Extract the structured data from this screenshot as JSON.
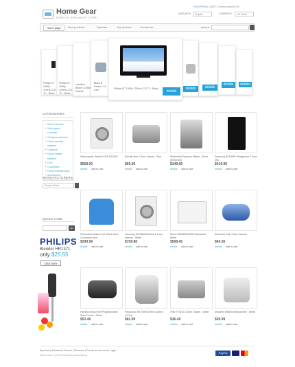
{
  "header": {
    "title": "Home Gear",
    "tagline": "DOMESTIC APPLIANCES STORE",
    "top_links": "SHOPPING CART   0 items total $0.00",
    "top_link_cart": "SHOPPING CART",
    "top_link_rest": "0 items total $0.00",
    "currency_label": "CURRENCY",
    "currency_value": "US Dollar",
    "language_label": "LANGUAGE",
    "language_value": "English"
  },
  "nav": {
    "items": [
      "Home page",
      "New products",
      "Specials",
      "My account",
      "Contact us"
    ],
    "search_label": "search"
  },
  "carousel": {
    "featured_text": "Philips 47\" 1080p 120Hz LCD TV - Black",
    "details_label": "details",
    "side_cards": [
      {
        "text": "Philips 47\" 1080p 120Hz LCD TV - Black"
      },
      {
        "text": "Hamilton Beach 4-Slice Toaster"
      },
      {
        "text": "Black & Decker 1.5-Liter"
      },
      {
        "text": "Black & Decker"
      }
    ]
  },
  "sidebar": {
    "categories_title": "CATEGORIES",
    "categories": [
      "Sound devices",
      "Video game consoles",
      "Cell phone/phones",
      "Home security systems",
      "Cameras",
      "Home theater systems",
      "DVD",
      "Computers",
      "Home entertainment",
      "Accessories"
    ],
    "manufacturers_title": "MANUFACTURERS",
    "manufacturers_select": "Please Select",
    "quick_find_title": "QUICK FIND",
    "quick_find_button": "go",
    "ad": {
      "brand": "PHILIPS",
      "product": "Blender HR1371",
      "only": "only",
      "price": "$25.55",
      "cta": "click here"
    }
  },
  "products": [
    {
      "name": "Samsung Air Perfect's WF-R125NC",
      "price": "$558.00",
      "icon": "washing-machine-icon"
    },
    {
      "name": "Breville Ikon 2-Slice Toaster - Blue",
      "price": "$65.95",
      "icon": "toaster-icon"
    },
    {
      "name": "KitchenAid Espresso Maker - Silver (KES2102)",
      "price": "$149.99",
      "icon": "espresso-icon"
    },
    {
      "name": "Samsung RS2555S Refrigerator 2 Door 35C",
      "price": "$419.99",
      "icon": "wine-cooler-icon"
    },
    {
      "name": "KitchenAid Artisan 5-Qt Stand Mixer Cornflower Blue",
      "price": "$299.99",
      "icon": "mixer-icon"
    },
    {
      "name": "Samsung WF338AAW/XAA 2-Load Washer - White",
      "price": "$708.88",
      "icon": "washing-machine-icon"
    },
    {
      "name": "Bosch SMS40E02GB Dishwasher White",
      "price": "$568.45",
      "icon": "dishwasher-icon"
    },
    {
      "name": "Electrolux Twin Clean Vacuum",
      "price": "$49.56",
      "icon": "vacuum-icon"
    },
    {
      "name": "Hamilton Beach Set Programmable Slow Cooker - Silver",
      "price": "$52.49",
      "icon": "slow-cooker-icon"
    },
    {
      "name": "Panasonic SR-TMH18 Rice Cooker - 10 Cup",
      "price": "$81.99",
      "icon": "rice-cooker-icon"
    },
    {
      "name": "Tefal TT3670 2-Slice Toaster - White",
      "price": "$36.49",
      "icon": "toaster-icon"
    },
    {
      "name": "Moulinex ME605 Meat grinder - White",
      "price": "$59.99",
      "icon": "meat-grinder-icon"
    }
  ],
  "product_actions": {
    "details": "details",
    "add": "add to cart"
  },
  "footer": {
    "links": "Specials  |  Advanced Search  |  Reviews  |  Create an Account  |  Login",
    "copyright": "Home Gear © 2011 Powered by osCommerce"
  },
  "colors": {
    "accent": "#27a3d8",
    "text": "#555555",
    "link": "#3aa0cc"
  }
}
